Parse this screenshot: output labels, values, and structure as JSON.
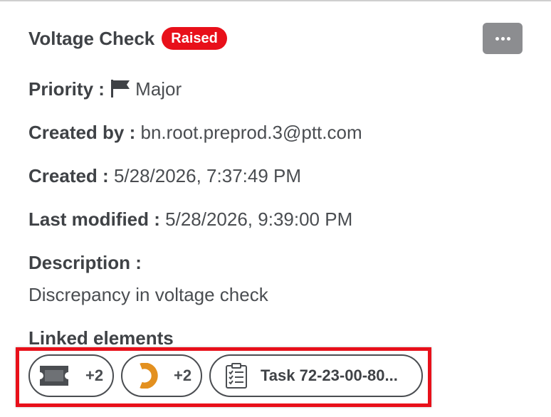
{
  "header": {
    "title": "Voltage Check",
    "status_badge": "Raised"
  },
  "fields": {
    "priority_label": "Priority :",
    "priority_value": "Major",
    "created_by_label": "Created by :",
    "created_by_value": "bn.root.preprod.3@ptt.com",
    "created_label": "Created :",
    "created_value": "5/28/2026, 7:37:49 PM",
    "last_modified_label": "Last modified :",
    "last_modified_value": "5/28/2026, 9:39:00 PM",
    "description_label": "Description :",
    "description_value": "Discrepancy in voltage check"
  },
  "linked": {
    "heading": "Linked elements",
    "chips": [
      {
        "icon": "ticket-icon",
        "count": "+2"
      },
      {
        "icon": "orange-ring-icon",
        "count": "+2"
      },
      {
        "icon": "clipboard-checklist-icon",
        "label": "Task 72-23-00-80..."
      }
    ]
  },
  "colors": {
    "badge": "#e8101a",
    "highlight_border": "#e8101a",
    "more_button": "#8c8d90",
    "ring_icon": "#e3901f"
  }
}
